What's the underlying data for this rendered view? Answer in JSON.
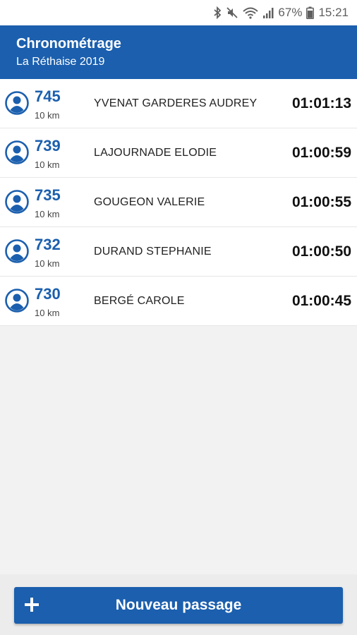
{
  "status_bar": {
    "battery_percent": "67%",
    "time": "15:21"
  },
  "app_bar": {
    "title": "Chronométrage",
    "subtitle": "La Réthaise 2019"
  },
  "colors": {
    "primary": "#1b5fae",
    "text": "#222222"
  },
  "runners": [
    {
      "bib": "745",
      "distance": "10 km",
      "name": "YVENAT GARDERES AUDREY",
      "time": "01:01:13"
    },
    {
      "bib": "739",
      "distance": "10 km",
      "name": "LAJOURNADE ELODIE",
      "time": "01:00:59"
    },
    {
      "bib": "735",
      "distance": "10 km",
      "name": "GOUGEON VALERIE",
      "time": "01:00:55"
    },
    {
      "bib": "732",
      "distance": "10 km",
      "name": "DURAND STEPHANIE",
      "time": "01:00:50"
    },
    {
      "bib": "730",
      "distance": "10 km",
      "name": "BERGÉ CAROLE",
      "time": "01:00:45"
    }
  ],
  "footer": {
    "button_label": "Nouveau passage",
    "button_icon": "plus-icon"
  }
}
